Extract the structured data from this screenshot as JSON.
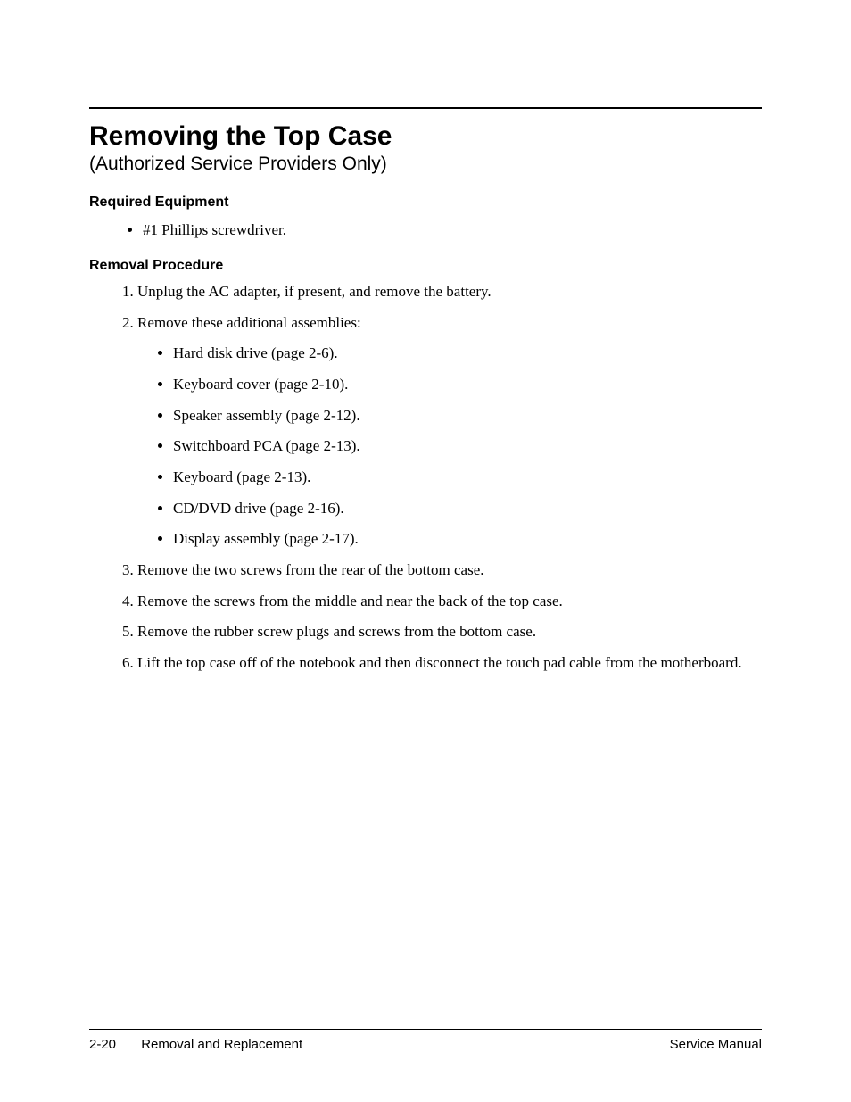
{
  "header": {
    "title": "Removing the Top Case",
    "subtitle": "(Authorized Service Providers Only)"
  },
  "sections": {
    "equipment_heading": "Required Equipment",
    "equipment_items": [
      "#1 Phillips screwdriver."
    ],
    "procedure_heading": "Removal Procedure",
    "steps": {
      "s1": "Unplug the AC adapter, if present, and remove the battery.",
      "s2": "Remove these additional assemblies:",
      "s2_items": [
        "Hard disk drive (page 2-6).",
        "Keyboard cover (page 2-10).",
        "Speaker assembly (page 2-12).",
        "Switchboard PCA (page 2-13).",
        "Keyboard (page 2-13).",
        "CD/DVD drive (page 2-16).",
        "Display assembly (page 2-17)."
      ],
      "s3": "Remove the two screws from the rear of the bottom case.",
      "s4": "Remove the screws from the middle and near the back of the top case.",
      "s5": "Remove the rubber screw plugs and screws from the bottom case.",
      "s6": "Lift the top case off of the notebook and then disconnect the touch pad cable from the motherboard."
    }
  },
  "footer": {
    "page_number": "2-20",
    "chapter": "Removal and Replacement",
    "doc_title": "Service Manual"
  }
}
